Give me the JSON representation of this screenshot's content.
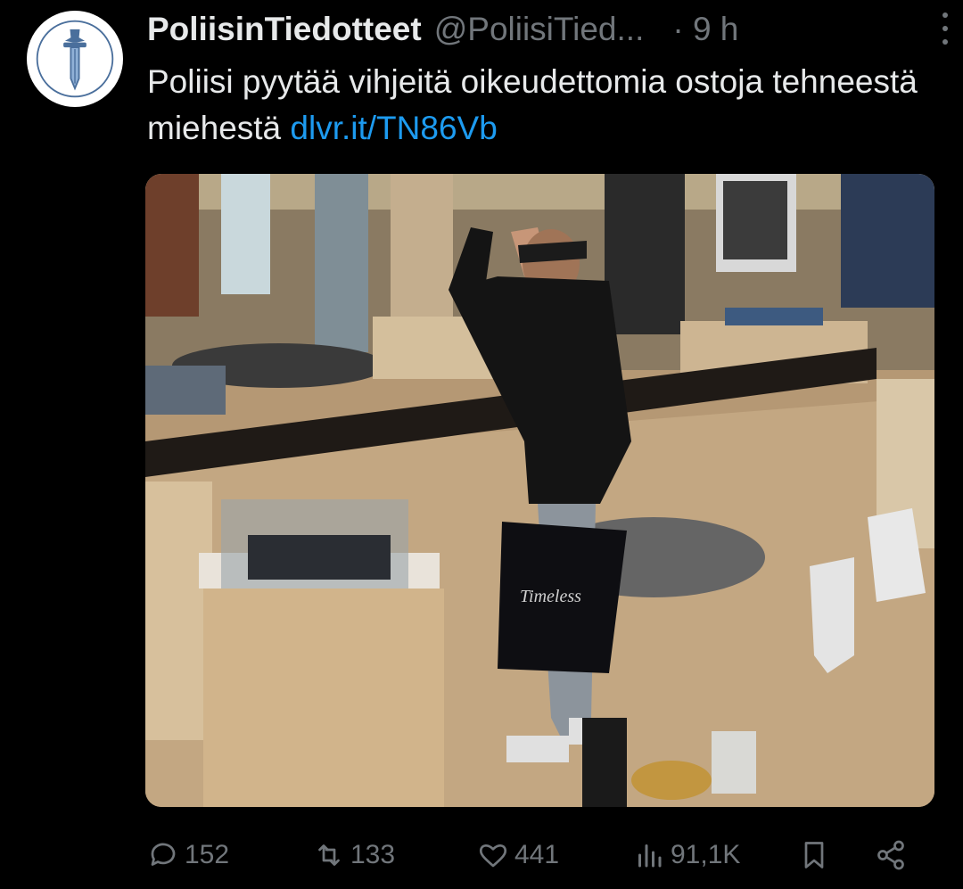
{
  "tweet": {
    "display_name": "PoliisinTiedotteet",
    "handle": "@PoliisiTied...",
    "time": "· 9 h",
    "text": "Poliisi pyytää vihjeitä oikeudettomia ostoja tehneestä miehestä",
    "link": "dlvr.it/TN86Vb",
    "avatar_icon": "police-emblem-icon",
    "more_icon": "more-vertical-icon"
  },
  "media": {
    "alt": "Security camera image of a smiling man in a black cap waving in a jewelry store, holding a black shopping bag",
    "bag_text": "Timeless"
  },
  "actions": {
    "replies": "152",
    "reposts": "133",
    "likes": "441",
    "views": "91,1K",
    "reply_icon": "reply-icon",
    "repost_icon": "repost-icon",
    "like_icon": "heart-icon",
    "views_icon": "views-icon",
    "bookmark_icon": "bookmark-icon",
    "share_icon": "share-icon"
  },
  "colors": {
    "background": "#000000",
    "text": "#e7e9ea",
    "secondary": "#71767b",
    "link": "#1d9bf0"
  }
}
